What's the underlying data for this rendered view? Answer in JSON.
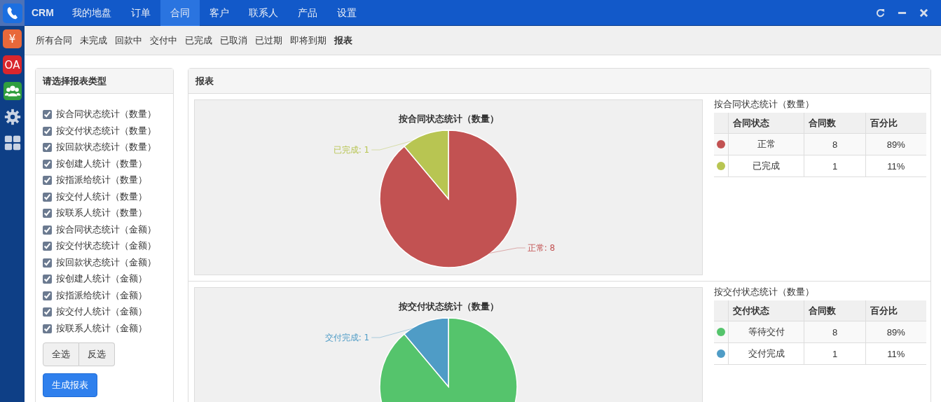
{
  "rail": [
    {
      "kind": "phone",
      "selected": true
    },
    {
      "kind": "text",
      "label": "¥",
      "color": "#e8683a",
      "selected": false
    },
    {
      "kind": "text",
      "label": "OA",
      "color": "#d9262c",
      "selected": false
    },
    {
      "kind": "people",
      "color": "#2f9e3f",
      "selected": false
    },
    {
      "kind": "gear",
      "selected": false
    },
    {
      "kind": "grid",
      "selected": false
    }
  ],
  "topbar": {
    "brand": "CRM",
    "items": [
      {
        "label": "我的地盘",
        "selected": false
      },
      {
        "label": "订单",
        "selected": false
      },
      {
        "label": "合同",
        "selected": true
      },
      {
        "label": "客户",
        "selected": false
      },
      {
        "label": "联系人",
        "selected": false
      },
      {
        "label": "产品",
        "selected": false
      },
      {
        "label": "设置",
        "selected": false
      }
    ]
  },
  "subnav": [
    {
      "label": "所有合同",
      "selected": false
    },
    {
      "label": "未完成",
      "selected": false
    },
    {
      "label": "回款中",
      "selected": false
    },
    {
      "label": "交付中",
      "selected": false
    },
    {
      "label": "已完成",
      "selected": false
    },
    {
      "label": "已取消",
      "selected": false
    },
    {
      "label": "已过期",
      "selected": false
    },
    {
      "label": "即将到期",
      "selected": false
    },
    {
      "label": "报表",
      "selected": true
    }
  ],
  "report_types": {
    "title": "请选择报表类型",
    "options": [
      {
        "label": "按合同状态统计（数量）",
        "checked": true
      },
      {
        "label": "按交付状态统计（数量）",
        "checked": true
      },
      {
        "label": "按回款状态统计（数量）",
        "checked": true
      },
      {
        "label": "按创建人统计（数量）",
        "checked": true
      },
      {
        "label": "按指派给统计（数量）",
        "checked": true
      },
      {
        "label": "按交付人统计（数量）",
        "checked": true
      },
      {
        "label": "按联系人统计（数量）",
        "checked": true
      },
      {
        "label": "按合同状态统计（金额）",
        "checked": true
      },
      {
        "label": "按交付状态统计（金额）",
        "checked": true
      },
      {
        "label": "按回款状态统计（金额）",
        "checked": true
      },
      {
        "label": "按创建人统计（金额）",
        "checked": true
      },
      {
        "label": "按指派给统计（金额）",
        "checked": true
      },
      {
        "label": "按交付人统计（金额）",
        "checked": true
      },
      {
        "label": "按联系人统计（金额）",
        "checked": true
      }
    ],
    "select_buttons": [
      "全选",
      "反选"
    ],
    "generate_button": "生成报表"
  },
  "reports": {
    "title": "报表",
    "items": [
      {
        "chart_data": {
          "type": "pie",
          "title": "按合同状态统计（数量）",
          "values": [
            8,
            1
          ],
          "value_labels": [
            "正常: 8",
            "已完成: 1"
          ]
        },
        "table": {
          "title": "按合同状态统计（数量）",
          "columns": [
            "合同状态",
            "合同数",
            "百分比"
          ],
          "rows": [
            {
              "color": "#c25252",
              "cells": [
                "正常",
                "8",
                "89%"
              ]
            },
            {
              "color": "#b8c552",
              "cells": [
                "已完成",
                "1",
                "11%"
              ]
            }
          ]
        }
      },
      {
        "chart_data": {
          "type": "pie",
          "title": "按交付状态统计（数量）",
          "values": [
            8,
            1
          ],
          "value_labels": [
            null,
            "交付完成: 1"
          ]
        },
        "table": {
          "title": "按交付状态统计（数量）",
          "columns": [
            "交付状态",
            "合同数",
            "百分比"
          ],
          "rows": [
            {
              "color": "#55c46c",
              "cells": [
                "等待交付",
                "8",
                "89%"
              ]
            },
            {
              "color": "#4f9cc6",
              "cells": [
                "交付完成",
                "1",
                "11%"
              ]
            }
          ]
        }
      }
    ]
  }
}
